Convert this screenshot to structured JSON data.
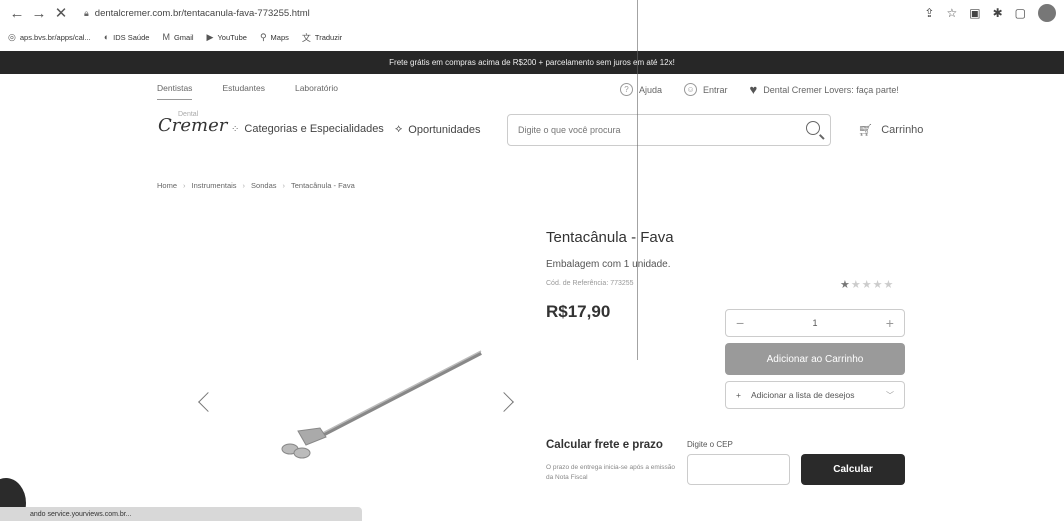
{
  "browser": {
    "url": "dentalcremer.com.br/tentacanula-fava-773255.html",
    "bookmarks": [
      "aps.bvs.br/apps/cal...",
      "IDS Saúde",
      "Gmail",
      "YouTube",
      "Maps",
      "Traduzir"
    ]
  },
  "promo": {
    "text": "Frete grátis em compras acima de R$200 + parcelamento sem juros em até 12x!"
  },
  "topnav": {
    "tabs": [
      "Dentistas",
      "Estudantes",
      "Laboratório"
    ],
    "help": "Ajuda",
    "login": "Entrar",
    "lovers": "Dental Cremer Lovers: faça parte!"
  },
  "header": {
    "logo_small": "Dental",
    "logo": "Cremer",
    "categories": "Categorias e Especialidades",
    "opportunities": "Oportunidades",
    "search_placeholder": "Digite o que você procura",
    "cart": "Carrinho"
  },
  "breadcrumb": [
    "Home",
    "Instrumentais",
    "Sondas",
    "Tentacânula - Fava"
  ],
  "product": {
    "title": "Tentacânula - Fava",
    "packaging": "Embalagem com 1 unidade.",
    "reference": "Cód. de Referência: 773255",
    "price": "R$17,90",
    "rating": 1,
    "rating_max": 5,
    "quantity": "1",
    "add_to_cart": "Adicionar ao Carrinho",
    "wishlist": "Adicionar a lista de desejos"
  },
  "shipping": {
    "title": "Calcular frete e prazo",
    "note": "O prazo de entrega inicia-se após a emissão da Nota Fiscal",
    "cep_label": "Digite o CEP",
    "calc_button": "Calcular"
  },
  "statusbar": {
    "text": "ando service.yourviews.com.br..."
  }
}
